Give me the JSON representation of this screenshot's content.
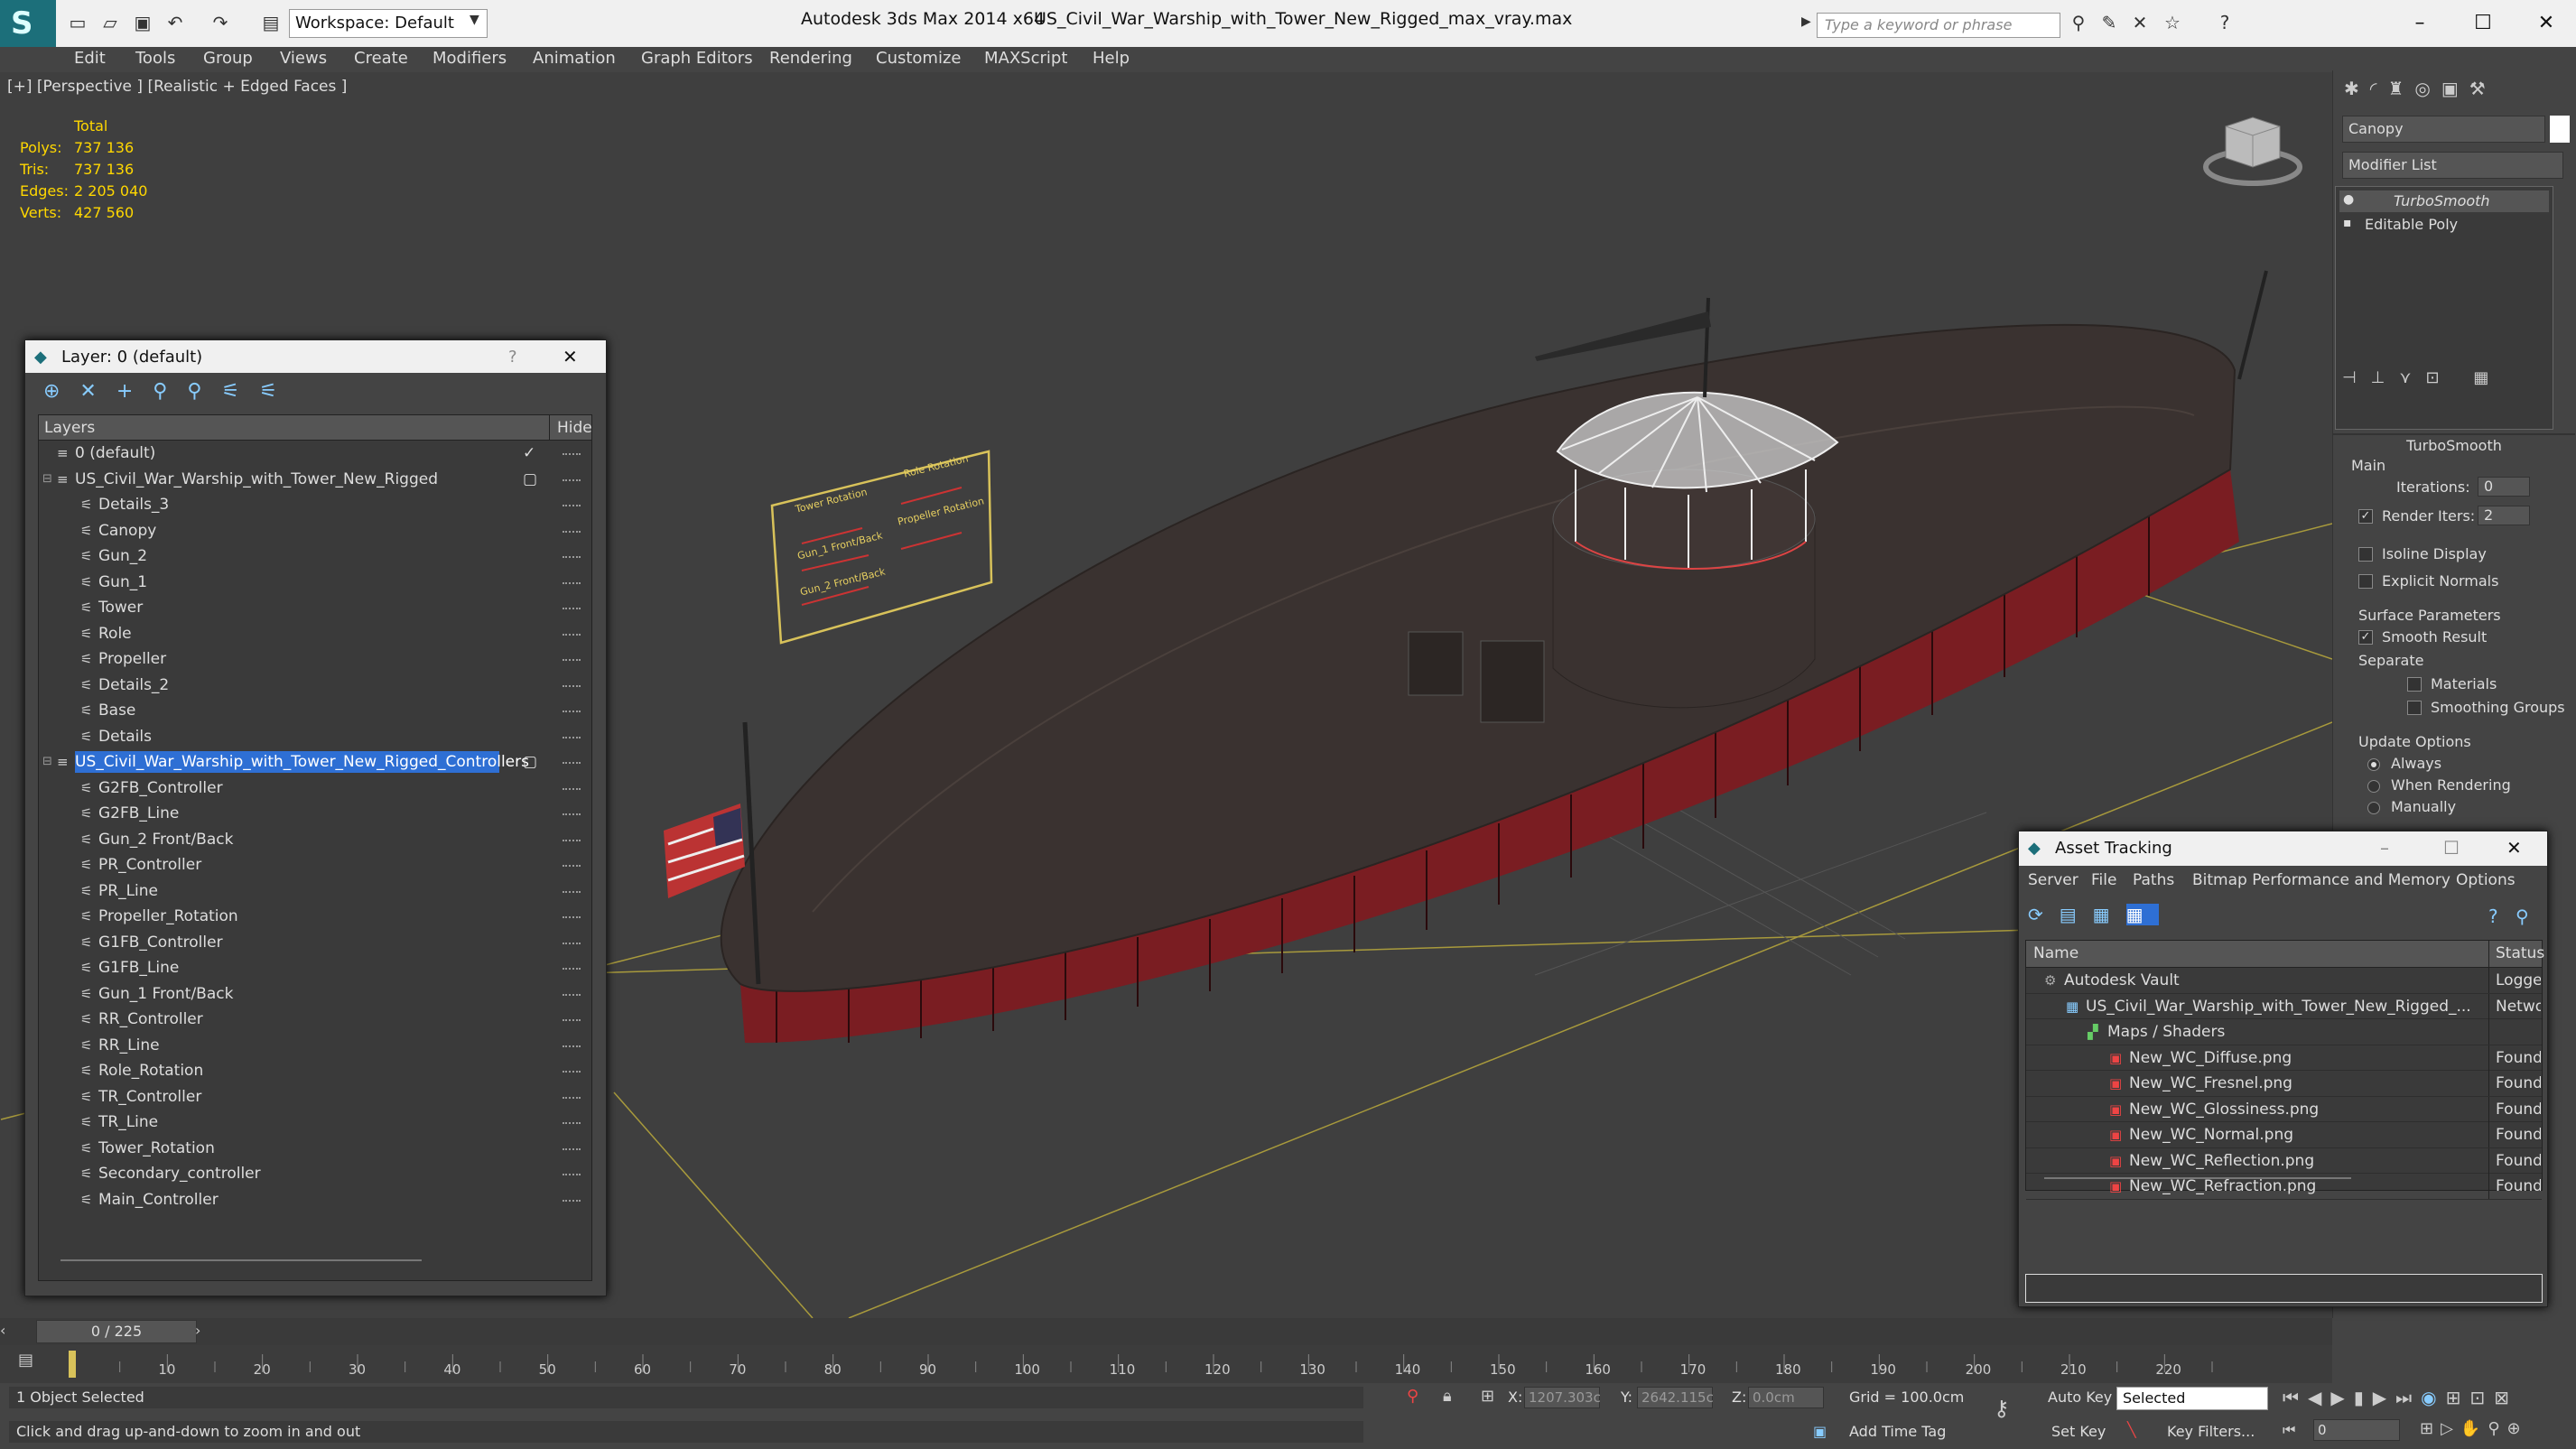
{
  "titlebar": {
    "workspace": "Workspace: Default",
    "app": "Autodesk 3ds Max  2014 x64",
    "file": "US_Civil_War_Warship_with_Tower_New_Rigged_max_vray.max",
    "search_placeholder": "Type a keyword or phrase"
  },
  "menu": [
    "Edit",
    "Tools",
    "Group",
    "Views",
    "Create",
    "Modifiers",
    "Animation",
    "Graph Editors",
    "Rendering",
    "Customize",
    "MAXScript",
    "Help"
  ],
  "viewport": {
    "label": "[+] [Perspective ] [Realistic + Edged Faces ]",
    "stats": {
      "header": "Total",
      "rows": [
        {
          "label": "Polys:",
          "value": "737 136"
        },
        {
          "label": "Tris:",
          "value": "737 136"
        },
        {
          "label": "Edges:",
          "value": "2 205 040"
        },
        {
          "label": "Verts:",
          "value": "427 560"
        }
      ]
    },
    "controller_labels": [
      "Tower Rotation",
      "Role Rotation",
      "Gun_1 Front/Back",
      "Propeller Rotation",
      "Gun_2 Front/Back"
    ]
  },
  "command_panel": {
    "object_name": "Canopy",
    "modifier_list": "Modifier List",
    "stack": [
      "TurboSmooth",
      "Editable Poly"
    ],
    "rollout": "TurboSmooth",
    "main_label": "Main",
    "iterations_label": "Iterations:",
    "iterations_value": "0",
    "render_iters_label": "Render Iters:",
    "render_iters_value": "2",
    "isoline": "Isoline Display",
    "explicit_normals": "Explicit Normals",
    "surface_params": "Surface Parameters",
    "smooth_result": "Smooth Result",
    "separate": "Separate",
    "materials": "Materials",
    "smoothing_groups": "Smoothing Groups",
    "update_options": "Update Options",
    "always": "Always",
    "when_rendering": "When Rendering",
    "manually": "Manually"
  },
  "layer_dialog": {
    "title": "Layer: 0 (default)",
    "help": "?",
    "col_layers": "Layers",
    "col_hide": "Hide",
    "rows": [
      {
        "name": "0 (default)",
        "level": 0,
        "check": "✓"
      },
      {
        "name": "US_Civil_War_Warship_with_Tower_New_Rigged",
        "level": 0,
        "check": "▢"
      },
      {
        "name": "Details_3",
        "level": 1
      },
      {
        "name": "Canopy",
        "level": 1
      },
      {
        "name": "Gun_2",
        "level": 1
      },
      {
        "name": "Gun_1",
        "level": 1
      },
      {
        "name": "Tower",
        "level": 1
      },
      {
        "name": "Role",
        "level": 1
      },
      {
        "name": "Propeller",
        "level": 1
      },
      {
        "name": "Details_2",
        "level": 1
      },
      {
        "name": "Base",
        "level": 1
      },
      {
        "name": "Details",
        "level": 1
      },
      {
        "name": "US_Civil_War_Warship_with_Tower_New_Rigged_Controllers",
        "level": 0,
        "check": "▢",
        "selected": true
      },
      {
        "name": "G2FB_Controller",
        "level": 1
      },
      {
        "name": "G2FB_Line",
        "level": 1
      },
      {
        "name": "Gun_2 Front/Back",
        "level": 1
      },
      {
        "name": "PR_Controller",
        "level": 1
      },
      {
        "name": "PR_Line",
        "level": 1
      },
      {
        "name": "Propeller_Rotation",
        "level": 1
      },
      {
        "name": "G1FB_Controller",
        "level": 1
      },
      {
        "name": "G1FB_Line",
        "level": 1
      },
      {
        "name": "Gun_1 Front/Back",
        "level": 1
      },
      {
        "name": "RR_Controller",
        "level": 1
      },
      {
        "name": "RR_Line",
        "level": 1
      },
      {
        "name": "Role_Rotation",
        "level": 1
      },
      {
        "name": "TR_Controller",
        "level": 1
      },
      {
        "name": "TR_Line",
        "level": 1
      },
      {
        "name": "Tower_Rotation",
        "level": 1
      },
      {
        "name": "Secondary_controller",
        "level": 1
      },
      {
        "name": "Main_Controller",
        "level": 1
      }
    ]
  },
  "asset_dialog": {
    "title": "Asset Tracking",
    "menu": [
      "Server",
      "File",
      "Paths",
      "Bitmap Performance and Memory",
      "Options"
    ],
    "col_name": "Name",
    "col_status": "Status",
    "rows": [
      {
        "name": "Autodesk Vault",
        "status": "Logged",
        "level": 0
      },
      {
        "name": "US_Civil_War_Warship_with_Tower_New_Rigged_...",
        "status": "Network",
        "level": 1
      },
      {
        "name": "Maps / Shaders",
        "status": "",
        "level": 2
      },
      {
        "name": "New_WC_Diffuse.png",
        "status": "Found",
        "level": 3
      },
      {
        "name": "New_WC_Fresnel.png",
        "status": "Found",
        "level": 3
      },
      {
        "name": "New_WC_Glossiness.png",
        "status": "Found",
        "level": 3
      },
      {
        "name": "New_WC_Normal.png",
        "status": "Found",
        "level": 3
      },
      {
        "name": "New_WC_Reflection.png",
        "status": "Found",
        "level": 3
      },
      {
        "name": "New_WC_Refraction.png",
        "status": "Found",
        "level": 3
      }
    ]
  },
  "timeline": {
    "frame": "0 / 225",
    "ticks": [
      "10",
      "20",
      "30",
      "40",
      "50",
      "60",
      "70",
      "80",
      "90",
      "100",
      "110",
      "120",
      "130",
      "140",
      "150",
      "160",
      "170",
      "180",
      "190",
      "200",
      "210",
      "220"
    ]
  },
  "status": {
    "selection": "1 Object Selected",
    "prompt": "Click and drag up-and-down to zoom in and out",
    "x_label": "X:",
    "x_value": "1207.303c",
    "y_label": "Y:",
    "y_value": "2642.115c",
    "z_label": "Z:",
    "z_value": "0.0cm",
    "grid": "Grid = 100.0cm",
    "add_time_tag": "Add Time Tag",
    "auto_key": "Auto Key",
    "set_key": "Set Key",
    "selected": "Selected",
    "key_filters": "Key Filters...",
    "frame_field": "0"
  }
}
